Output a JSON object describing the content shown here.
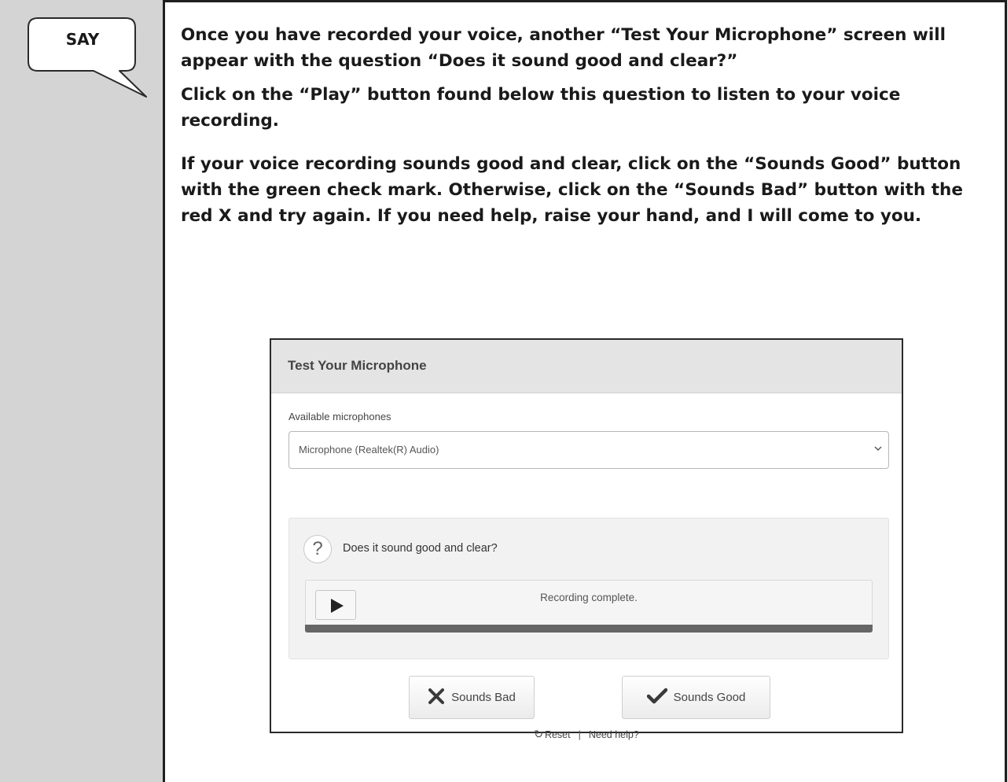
{
  "say_label": "SAY",
  "instructions": {
    "p1": "Once you have recorded your voice, another “Test Your Microphone” screen will appear with the question “Does it sound good and clear?”",
    "p2": "Click on the “Play” button found below this question to listen to your voice recording.",
    "p3": "If your voice recording sounds good and clear, click on the “Sounds Good” button with the green check mark. Otherwise, click on the “Sounds Bad” button with the red X and try again. If you need help, raise your hand, and I will come to you."
  },
  "dialog": {
    "title": "Test Your Microphone",
    "mic_label": "Available microphones",
    "mic_selected": "Microphone (Realtek(R) Audio)",
    "question_icon": "question-mark-icon",
    "question": "Does it sound good and clear?",
    "play_icon": "play-icon",
    "recording_status": "Recording complete.",
    "buttons": {
      "bad": {
        "label": "Sounds Bad",
        "icon": "x-icon"
      },
      "good": {
        "label": "Sounds Good",
        "icon": "checkmark-icon"
      }
    },
    "footer": {
      "reset_icon": "reset-icon",
      "reset": "Reset",
      "separator": "|",
      "help": "Need help?"
    }
  },
  "colors": {
    "sidebar_bg": "#d4d4d4",
    "header_bg": "#e4e4e4",
    "progress_bar": "#666666"
  }
}
